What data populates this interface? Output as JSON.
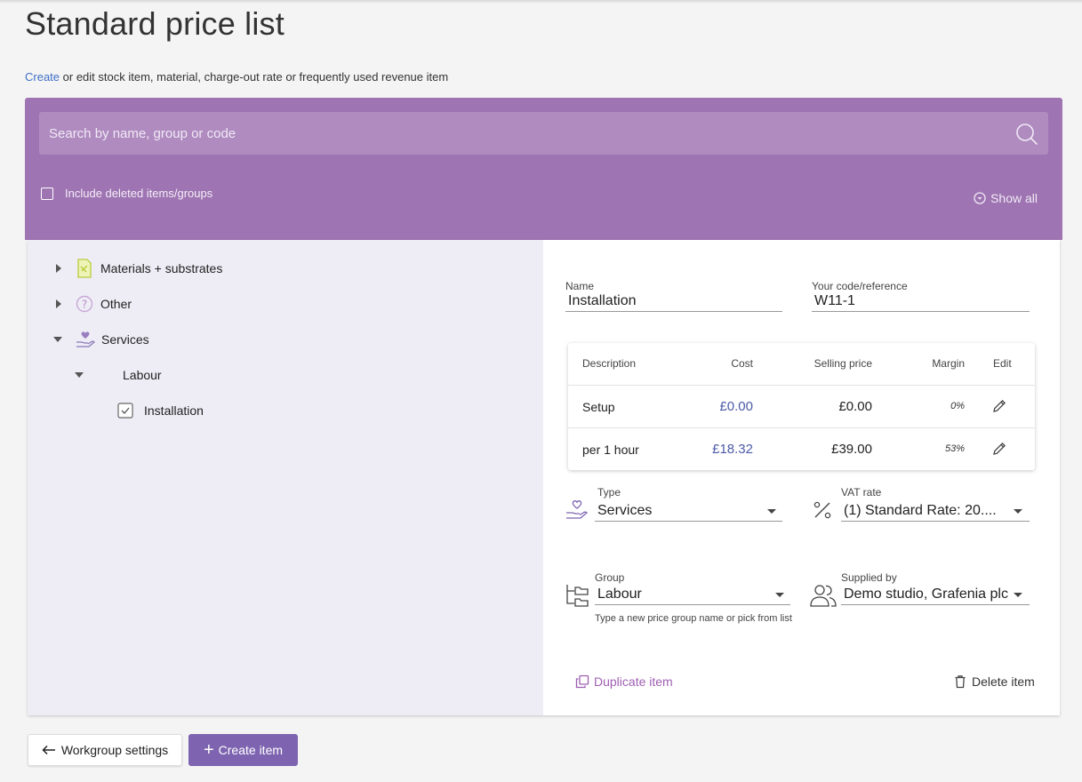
{
  "page": {
    "title": "Standard price list",
    "subtitle_link": "Create",
    "subtitle_rest": " or edit stock item, material, charge-out rate or frequently used revenue item"
  },
  "search": {
    "placeholder": "Search by name, group or code",
    "include_deleted_label": "Include deleted items/groups",
    "show_all_label": "Show all",
    "panel_color": "#9e74b2"
  },
  "tree": {
    "items": [
      {
        "label": "Materials + substrates",
        "expanded": false,
        "icon": "document-icon"
      },
      {
        "label": "Other",
        "expanded": false,
        "icon": "question-icon"
      },
      {
        "label": "Services",
        "expanded": true,
        "icon": "hand-heart-icon"
      },
      {
        "label": "Labour",
        "expanded": true
      },
      {
        "label": "Installation",
        "checked": true
      }
    ]
  },
  "detail": {
    "name_label": "Name",
    "name_value": "Installation",
    "code_label": "Your code/reference",
    "code_value": "W11-1",
    "table": {
      "headers": [
        "Description",
        "Cost",
        "Selling price",
        "Margin",
        "Edit"
      ],
      "rows": [
        {
          "description": "Setup",
          "cost": "£0.00",
          "selling_price": "£0.00",
          "margin": "0%"
        },
        {
          "description": "per 1 hour",
          "cost": "£18.32",
          "selling_price": "£39.00",
          "margin": "53%"
        }
      ]
    },
    "type_label": "Type",
    "type_value": "Services",
    "vat_label": "VAT rate",
    "vat_value": "(1) Standard Rate: 20....",
    "group_label": "Group",
    "group_value": "Labour",
    "group_helper": "Type a new price group name or pick from list",
    "supplied_label": "Supplied by",
    "supplied_value": "Demo studio, Grafenia plc",
    "duplicate_label": "Duplicate item",
    "delete_label": "Delete item",
    "accent_color": "#9e5fb2"
  },
  "footer": {
    "back_label": "Workgroup settings",
    "create_label": "Create item",
    "create_color": "#7e64b0"
  }
}
